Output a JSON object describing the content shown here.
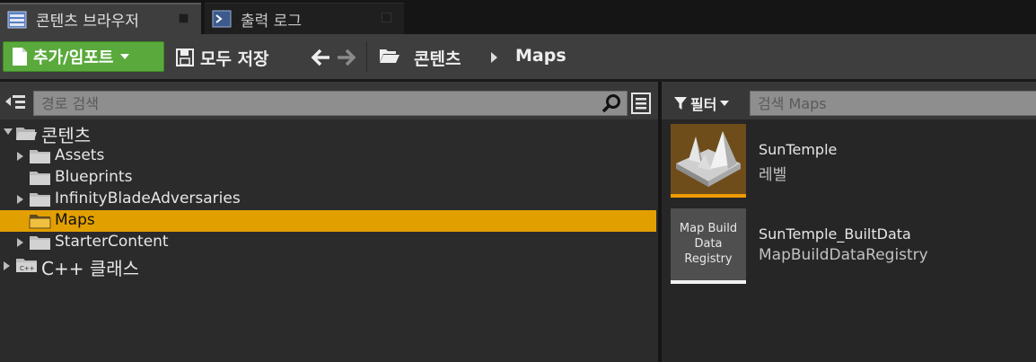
{
  "tabs": [
    {
      "label": "콘텐츠 브라우저",
      "icon": "content-browser-icon",
      "active": true
    },
    {
      "label": "출력 로그",
      "icon": "output-log-icon",
      "active": false
    }
  ],
  "toolbar": {
    "add_label": "추가/임포트",
    "save_all_label": "모두 저장",
    "breadcrumb": [
      "콘텐츠",
      "Maps"
    ]
  },
  "left_panel": {
    "search_placeholder": "경로 검색",
    "tree": [
      {
        "label": "콘텐츠",
        "expanded": true,
        "selected": false
      },
      {
        "label": "Assets",
        "expanded": false,
        "selected": false
      },
      {
        "label": "Blueprints",
        "expanded": false,
        "selected": false
      },
      {
        "label": "InfinityBladeAdversaries",
        "expanded": false,
        "selected": false
      },
      {
        "label": "Maps",
        "expanded": false,
        "selected": true
      },
      {
        "label": "StarterContent",
        "expanded": false,
        "selected": false
      },
      {
        "label": "C++ 클래스",
        "expanded": false,
        "selected": false
      }
    ]
  },
  "right_panel": {
    "filter_label": "필터",
    "search_placeholder": "검색 Maps",
    "assets": [
      {
        "name": "SunTemple",
        "type": "레벨",
        "thumbnail": "level-thumbnail",
        "accent": "#ee9a00"
      },
      {
        "name": "SunTemple_BuiltData",
        "type": "MapBuildDataRegistry",
        "thumbnail_text": "Map Build Data Registry",
        "accent": "#f2f2f2"
      }
    ]
  },
  "colors": {
    "selection": "#e2a000",
    "add_button": "#5aa93c",
    "panel_bg": "#2b2b2b"
  }
}
